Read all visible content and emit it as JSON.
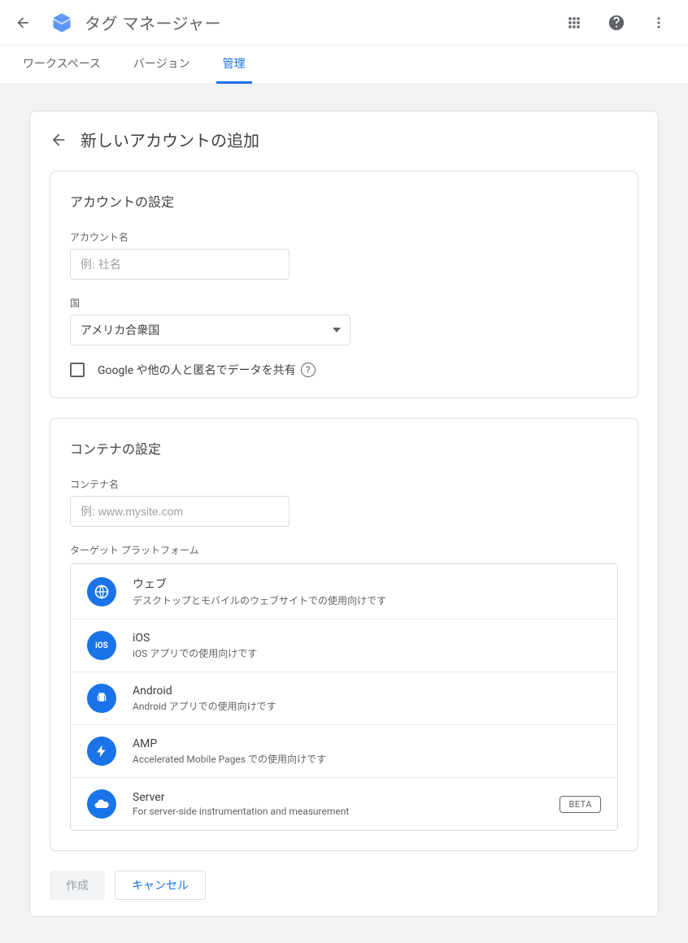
{
  "header": {
    "app_title": "タグ マネージャー"
  },
  "tabs": [
    {
      "label": "ワークスペース",
      "active": false
    },
    {
      "label": "バージョン",
      "active": false
    },
    {
      "label": "管理",
      "active": true
    }
  ],
  "page": {
    "title": "新しいアカウントの追加"
  },
  "account_section": {
    "title": "アカウントの設定",
    "name_label": "アカウント名",
    "name_placeholder": "例: 社名",
    "country_label": "国",
    "country_value": "アメリカ合衆国",
    "share_label": "Google や他の人と匿名でデータを共有"
  },
  "container_section": {
    "title": "コンテナの設定",
    "name_label": "コンテナ名",
    "name_placeholder": "例: www.mysite.com",
    "platform_label": "ターゲット プラットフォーム",
    "platforms": [
      {
        "name": "ウェブ",
        "desc": "デスクトップとモバイルのウェブサイトでの使用向けです"
      },
      {
        "name": "iOS",
        "desc": "iOS アプリでの使用向けです"
      },
      {
        "name": "Android",
        "desc": "Android アプリでの使用向けです"
      },
      {
        "name": "AMP",
        "desc": "Accelerated Mobile Pages での使用向けです"
      },
      {
        "name": "Server",
        "desc": "For server-side instrumentation and measurement",
        "badge": "BETA"
      }
    ]
  },
  "actions": {
    "create": "作成",
    "cancel": "キャンセル"
  }
}
